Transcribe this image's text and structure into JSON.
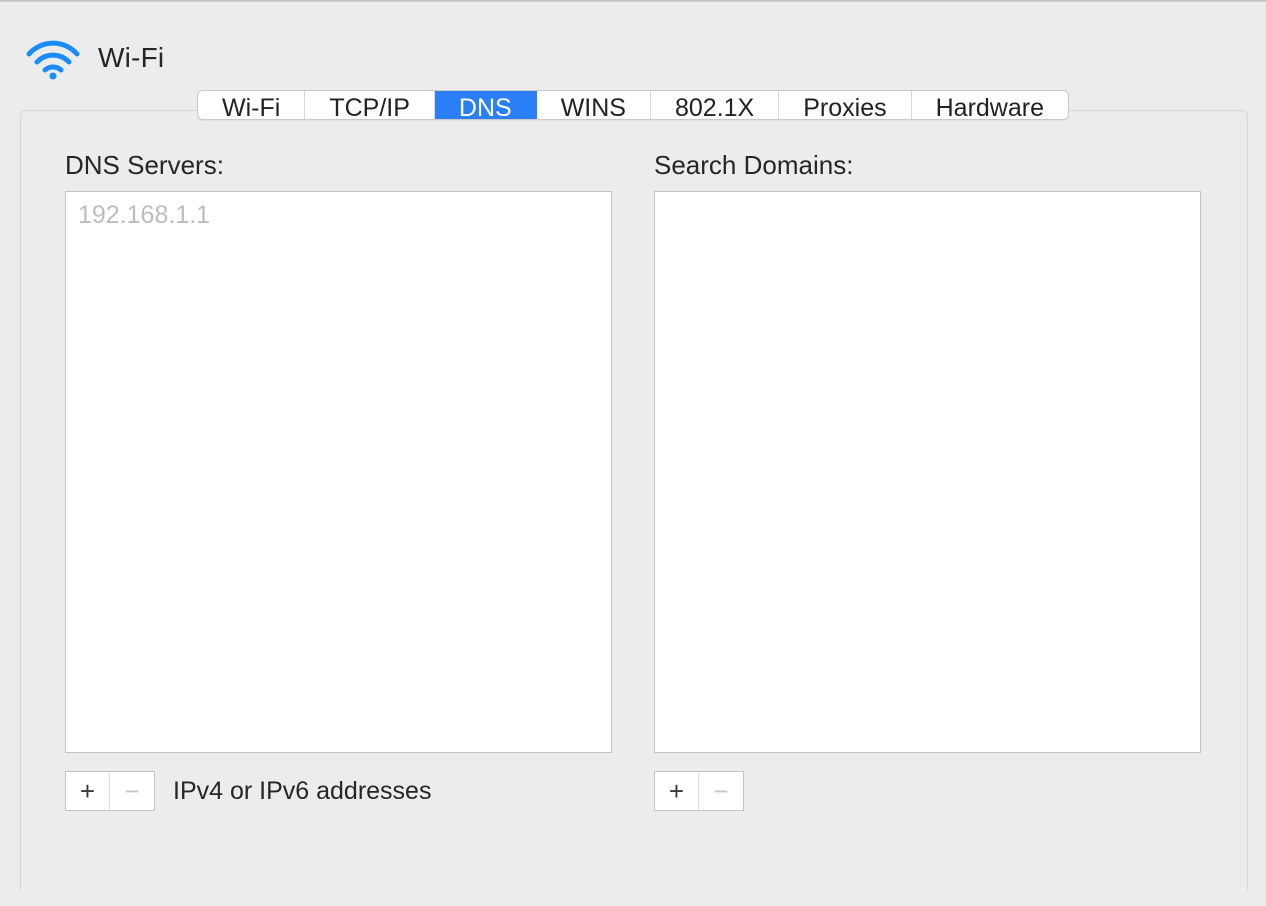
{
  "header": {
    "title": "Wi-Fi"
  },
  "tabs": {
    "items": [
      "Wi-Fi",
      "TCP/IP",
      "DNS",
      "WINS",
      "802.1X",
      "Proxies",
      "Hardware"
    ],
    "active_index": 2
  },
  "dns": {
    "servers_label": "DNS Servers:",
    "servers": [
      "192.168.1.1"
    ],
    "hint": "IPv4 or IPv6 addresses"
  },
  "search_domains": {
    "label": "Search Domains:",
    "domains": []
  },
  "buttons": {
    "plus": "+",
    "minus": "−"
  }
}
